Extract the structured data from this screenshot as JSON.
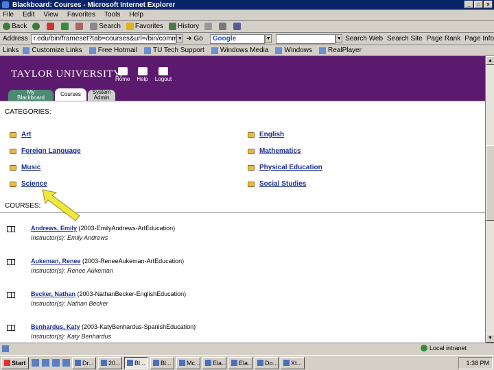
{
  "window": {
    "title": "Blackboard: Courses - Microsoft Internet Explorer"
  },
  "menu": [
    "File",
    "Edit",
    "View",
    "Favorites",
    "Tools",
    "Help"
  ],
  "toolbar": {
    "back": "Back",
    "search": "Search",
    "favorites": "Favorites",
    "history": "History"
  },
  "address": {
    "label": "Address",
    "url": "r.edu/bin/frameset?tab=courses&url=/bin/common/...",
    "go": "Go"
  },
  "google": {
    "brand": "Google",
    "search_web": "Search Web",
    "search_site": "Search Site",
    "page_rank": "Page Rank",
    "page_info": "Page Info"
  },
  "links": {
    "label": "Links",
    "items": [
      "Customize Links",
      "Free Hotmail",
      "TU Tech Support",
      "Windows Media",
      "Windows",
      "RealPlayer"
    ]
  },
  "header": {
    "logo": "TAYLOR UNIVERSITY.",
    "icons": [
      {
        "label": "Home"
      },
      {
        "label": "Help"
      },
      {
        "label": "Logout"
      }
    ],
    "tabs": [
      "My Blackboard",
      "Courses",
      "System Admin"
    ]
  },
  "categories": {
    "label": "CATEGORIES:",
    "left": [
      "Art",
      "Foreign Language",
      "Music",
      "Science"
    ],
    "right": [
      "English",
      "Mathematics",
      "Physical Education",
      "Social Studies"
    ]
  },
  "courses": {
    "label": "COURSES:",
    "items": [
      {
        "name": "Andrews, Emily",
        "code": "(2003-EmilyAndrews-ArtEducation)",
        "instructor": "Instructor(s): Emily Andrews"
      },
      {
        "name": "Aukeman, Renee",
        "code": "(2003-ReneeAukeman-ArtEducation)",
        "instructor": "Instructor(s): Renee Aukeman"
      },
      {
        "name": "Becker, Nathan",
        "code": "(2003-NathanBecker-EnglishEducation)",
        "instructor": "Instructor(s): Nathan Becker"
      },
      {
        "name": "Benhardus, Katy",
        "code": "(2003-KatyBenhardus-SpanishEducation)",
        "instructor": "Instructor(s): Katy Benhardus"
      }
    ]
  },
  "status": {
    "zone": "Local intranet"
  },
  "taskbar": {
    "start": "Start",
    "items": [
      "Dr...",
      "20...",
      "Bl...",
      "Bl...",
      "Mc...",
      "Ela...",
      "Ela...",
      "Do...",
      "Xt..."
    ],
    "clock": "1:38 PM"
  },
  "colors": {
    "header_bg": "#5c1a6e",
    "tab_green": "#4d8a73",
    "link": "#1a2e8c",
    "arrow": "#f0e63c"
  }
}
